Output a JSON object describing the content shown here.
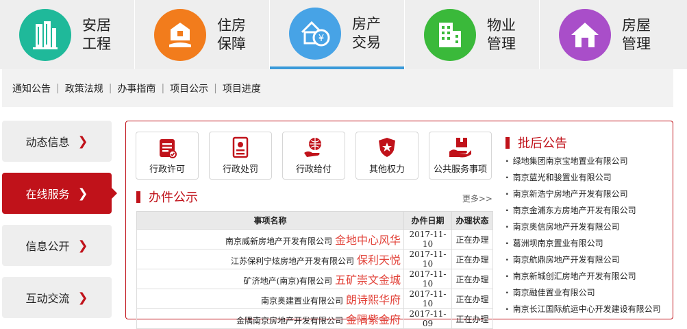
{
  "categories": [
    {
      "label": "安居工程",
      "line1": "安居",
      "line2": "工程",
      "color": "#1fb99a",
      "icon": "building-icon"
    },
    {
      "label": "住房保障",
      "line1": "住房",
      "line2": "保障",
      "color": "#f27c1c",
      "icon": "house-hand-icon"
    },
    {
      "label": "房产交易",
      "line1": "房产",
      "line2": "交易",
      "color": "#47a3e6",
      "icon": "house-yuan-icon"
    },
    {
      "label": "物业管理",
      "line1": "物业",
      "line2": "管理",
      "color": "#3ab93a",
      "icon": "office-building-icon"
    },
    {
      "label": "房屋管理",
      "line1": "房屋",
      "line2": "管理",
      "color": "#a94ec9",
      "icon": "home-icon"
    }
  ],
  "subnav": [
    "通知公告",
    "政策法规",
    "办事指南",
    "项目公示",
    "项目进度"
  ],
  "side_menu": [
    {
      "label": "动态信息",
      "active": false
    },
    {
      "label": "在线服务",
      "active": true
    },
    {
      "label": "信息公开",
      "active": false
    },
    {
      "label": "互动交流",
      "active": false
    }
  ],
  "services": [
    {
      "label": "行政许可",
      "icon": "clipboard-check-icon"
    },
    {
      "label": "行政处罚",
      "icon": "document-stamp-icon"
    },
    {
      "label": "行政给付",
      "icon": "hand-globe-icon"
    },
    {
      "label": "其他权力",
      "icon": "shield-star-icon"
    },
    {
      "label": "公共服务事项",
      "icon": "hand-box-icon"
    }
  ],
  "cases": {
    "title": "办件公示",
    "more": "更多>>",
    "columns": [
      "事项名称",
      "办件日期",
      "办理状态"
    ],
    "rows": [
      {
        "company": "南京威新房地产开发有限公司",
        "project": "金地中心风华",
        "date": "2017-11-10",
        "status": "正在办理"
      },
      {
        "company": "江苏保利宁炫房地产开发有限公司",
        "project": "保利天悦",
        "date": "2017-11-10",
        "status": "正在办理"
      },
      {
        "company": "矿济地产(南京)有限公司",
        "project": "五矿崇文金城",
        "date": "2017-11-10",
        "status": "正在办理"
      },
      {
        "company": "南京奥建置业有限公司",
        "project": "朗诗熙华府",
        "date": "2017-11-10",
        "status": "正在办理"
      },
      {
        "company": "金隅南京房地产开发有限公司",
        "project": "金隅紫金府",
        "date": "2017-11-09",
        "status": "正在办理"
      }
    ]
  },
  "notices": {
    "title": "批后公告",
    "items": [
      "绿地集团南京宝地置业有限公司",
      "南京蓝光和骏置业有限公司",
      "南京新浩宁房地产开发有限公司",
      "南京金浦东方房地产开发有限公司",
      "南京奥信房地产开发有限公司",
      "葛洲坝南京置业有限公司",
      "南京航鼎房地产开发有限公司",
      "南京新城创汇房地产开发有限公司",
      "南京融佳置业有限公司",
      "南京长江国际航运中心开发建设有限公司"
    ]
  },
  "accent_color": "#c0121a"
}
